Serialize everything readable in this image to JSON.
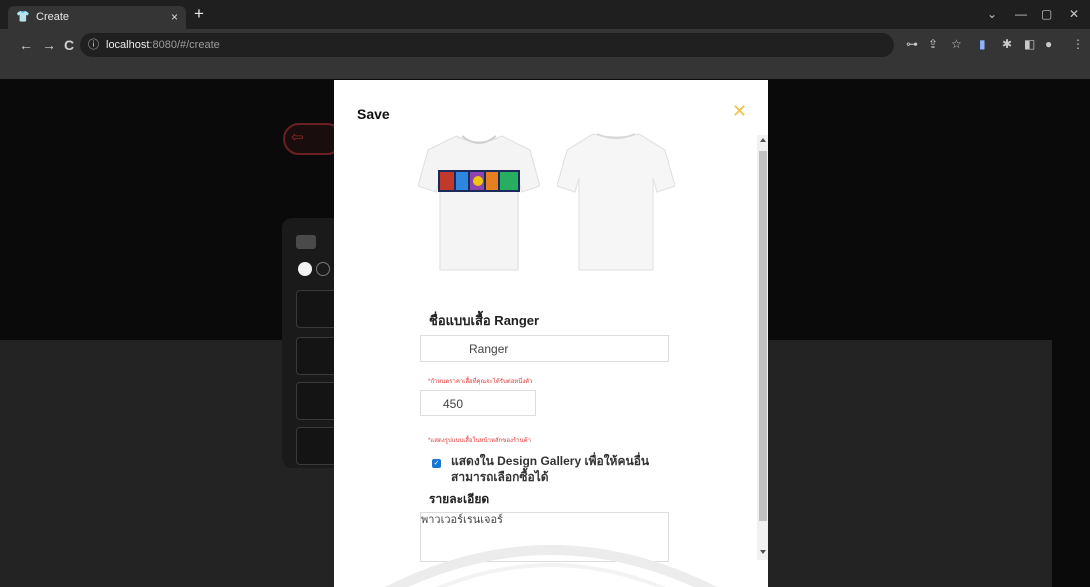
{
  "browser": {
    "tab_title": "Create",
    "new_tab": "+",
    "tab_close": "×",
    "url_host": "localhost",
    "url_path": ":8080/#/create",
    "window_min": "—",
    "window_max": "▢",
    "window_close": "✕",
    "back": "←",
    "forward": "→",
    "reload": "C"
  },
  "modal": {
    "title": "Save",
    "close": "✕",
    "name_label": "ชื่อแบบเสื้อ Ranger",
    "name_value": "Ranger",
    "price_hint": "*กำหนดราคาเสื้อที่คุณจะได้รับต่อหนึ่งตัว",
    "price_value": "450",
    "gallery_hint": "*แสดงรูปแบบเสื้อในหน้าหลักของร้านค้า",
    "gallery_checkbox_label": "แสดงใน Design Gallery เพื่อให้คนอื่นสามารถเลือกซื้อได้",
    "gallery_checked": true,
    "detail_label": "รายละเอียด",
    "detail_value": "พาวเวอร์เรนเจอร์"
  },
  "colors": {
    "accent_close": "#f0c24a",
    "checkbox": "#1976d2",
    "hint_red": "#e33a3a"
  }
}
